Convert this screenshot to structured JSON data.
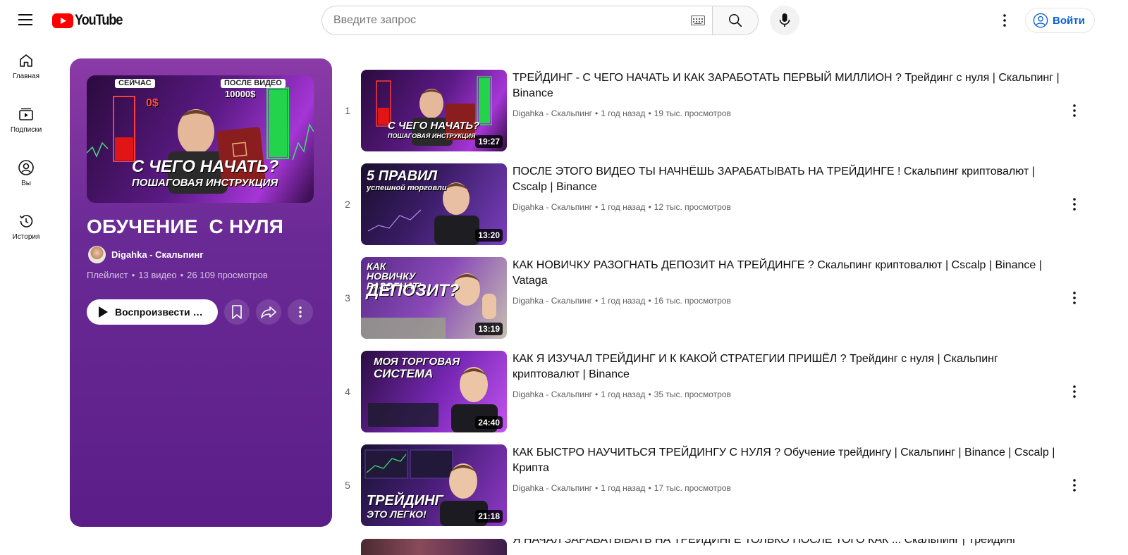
{
  "header": {
    "logo_text": "YouTube",
    "search_placeholder": "Введите запрос",
    "signin_label": "Войти"
  },
  "guide": {
    "items": [
      {
        "label": "Главная",
        "icon": "home-icon"
      },
      {
        "label": "Подписки",
        "icon": "subscriptions-icon"
      },
      {
        "label": "Вы",
        "icon": "you-icon"
      },
      {
        "label": "История",
        "icon": "history-icon"
      }
    ]
  },
  "playlist": {
    "title": "ОБУЧЕНИЕ  С НУЛЯ",
    "owner": "Digahka - Скальпинг",
    "type_label": "Плейлист",
    "video_count": "13 видео",
    "views": "26 109 просмотров",
    "separator": "•",
    "play_label": "Воспроизвести все",
    "thumb": {
      "caption_top_left": "СЕЙЧАС",
      "caption_top_right": "ПОСЛЕ ВИДЕО",
      "amount_left": "0$",
      "amount_right": "10000$",
      "caption_main": "С ЧЕГО НАЧАТЬ?",
      "caption_sub": "ПОШАГОВАЯ ИНСТРУКЦИЯ"
    }
  },
  "videos": [
    {
      "index": "1",
      "title": "ТРЕЙДИНГ - С ЧЕГО НАЧАТЬ И КАК ЗАРАБОТАТЬ ПЕРВЫЙ МИЛЛИОН ? Трейдинг с нуля | Скальпинг | Binance",
      "channel": "Digahka - Скальпинг",
      "age": "1 год назад",
      "views": "19 тыс. просмотров",
      "duration": "19:27",
      "thumb_caption": "С ЧЕГО НАЧАТЬ?",
      "thumb_sub": "ПОШАГОВАЯ ИНСТРУКЦИЯ"
    },
    {
      "index": "2",
      "title": "ПОСЛЕ ЭТОГО ВИДЕО ТЫ НАЧНЁШЬ ЗАРАБАТЫВАТЬ НА ТРЕЙДИНГЕ ! Скальпинг криптовалют | Cscalp | Binance",
      "channel": "Digahka - Скальпинг",
      "age": "1 год назад",
      "views": "12 тыс. просмотров",
      "duration": "13:20",
      "thumb_caption": "5 ПРАВИЛ",
      "thumb_sub": "успешной торговли"
    },
    {
      "index": "3",
      "title": "КАК НОВИЧКУ РАЗОГНАТЬ ДЕПОЗИТ НА ТРЕЙДИНГЕ ? Скальпинг криптовалют | Cscalp | Binance | Vataga",
      "channel": "Digahka - Скальпинг",
      "age": "1 год назад",
      "views": "16 тыс. просмотров",
      "duration": "13:19",
      "thumb_caption": "КАК НОВИЧКУ РАЗОГНАТЬ",
      "thumb_sub": "ДЕПОЗИТ?"
    },
    {
      "index": "4",
      "title": "КАК Я ИЗУЧАЛ ТРЕЙДИНГ И К КАКОЙ СТРАТЕГИИ ПРИШЁЛ ? Трейдинг с нуля | Скальпинг криптовалют | Binance",
      "channel": "Digahka - Скальпинг",
      "age": "1 год назад",
      "views": "35 тыс. просмотров",
      "duration": "24:40",
      "thumb_caption": "МОЯ ТОРГОВАЯ",
      "thumb_sub": "СИСТЕМА"
    },
    {
      "index": "5",
      "title": "КАК БЫСТРО НАУЧИТЬСЯ ТРЕЙДИНГУ С НУЛЯ ? Обучение трейдингу | Скальпинг | Binance | Cscalp | Крипта",
      "channel": "Digahka - Скальпинг",
      "age": "1 год назад",
      "views": "17 тыс. просмотров",
      "duration": "21:18",
      "thumb_caption": "ТРЕЙДИНГ",
      "thumb_sub": "ЭТО ЛЕГКО!"
    }
  ],
  "peek_title": "Я НАЧАЛ ЗАРАБАТЫВАТЬ НА ТРЕЙДИНГЕ ТОЛЬКО ПОСЛЕ ТОГО КАК ... Скальпинг | Трейдинг",
  "colors": {
    "brand_red": "#ff0000",
    "link_blue": "#065fd4",
    "playlist_bg": "#6a2a96"
  }
}
